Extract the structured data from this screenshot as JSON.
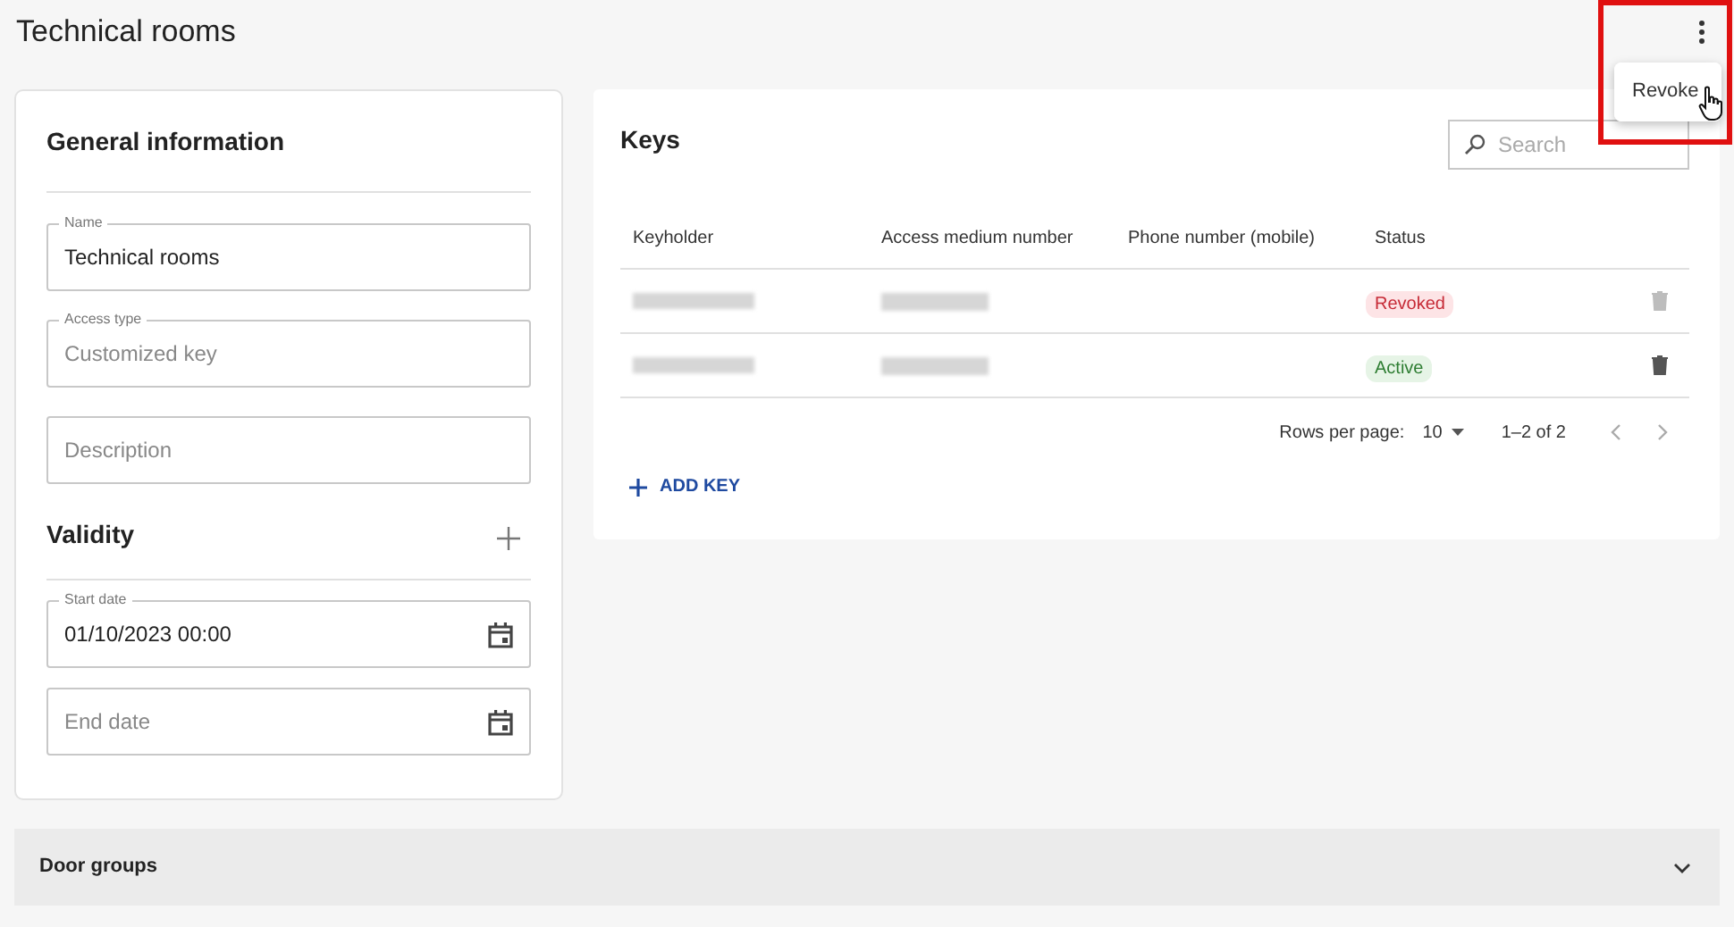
{
  "page": {
    "title": "Technical rooms"
  },
  "menu": {
    "items": [
      {
        "label": "Revoke"
      }
    ]
  },
  "general": {
    "title": "General information",
    "fields": [
      {
        "label": "Name",
        "value": "Technical rooms"
      },
      {
        "label": "Access type",
        "value": "Customized key",
        "disabled": true
      },
      {
        "placeholder": "Description"
      }
    ]
  },
  "validity": {
    "title": "Validity",
    "fields": [
      {
        "label": "Start date",
        "value": "01/10/2023 00:00"
      },
      {
        "placeholder": "End date"
      }
    ]
  },
  "keys": {
    "title": "Keys",
    "search": {
      "placeholder": "Search"
    },
    "columns": [
      "Keyholder",
      "Access medium number",
      "Phone number (mobile)",
      "Status"
    ],
    "rows": [
      {
        "status": "Revoked",
        "kind": "revoked",
        "delete_disabled": true
      },
      {
        "status": "Active",
        "kind": "active",
        "delete_disabled": false
      }
    ],
    "rows_per_page_label": "Rows per page:",
    "rows_per_page": "10",
    "range": "1–2 of 2",
    "add_label": "ADD KEY"
  },
  "door_groups": {
    "title": "Door groups",
    "expanded": false
  }
}
